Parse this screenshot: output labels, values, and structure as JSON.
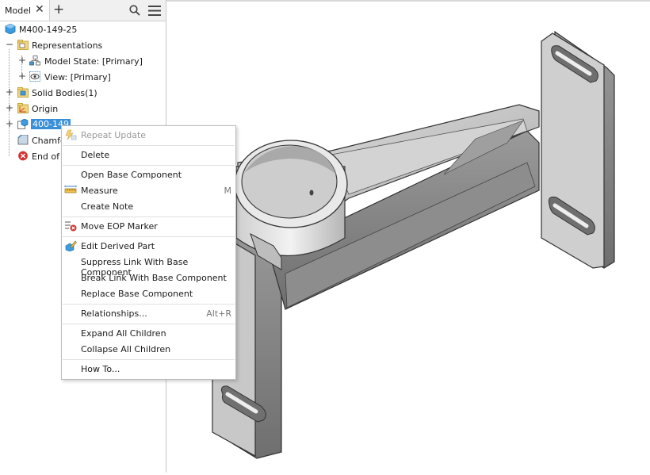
{
  "browser": {
    "tab_label": "Model",
    "tab_close": "✕",
    "tab_add": "+",
    "tree": {
      "root": "M400-149-25",
      "representations": "Representations",
      "model_state": "Model State: [Primary]",
      "view": "View: [Primary]",
      "solid_bodies": "Solid Bodies(1)",
      "origin": "Origin",
      "derived_part": "400-149",
      "chamfer": "Chamfe",
      "end_of_part": "End of P"
    }
  },
  "context_menu": {
    "items": [
      {
        "label": "Repeat Update",
        "shortcut": "",
        "enabled": false
      },
      {
        "label": "Delete",
        "shortcut": "",
        "enabled": true
      },
      {
        "label": "Open Base Component",
        "shortcut": "",
        "enabled": true
      },
      {
        "label": "Measure",
        "shortcut": "M",
        "enabled": true
      },
      {
        "label": "Create Note",
        "shortcut": "",
        "enabled": true
      },
      {
        "label": "Move EOP Marker",
        "shortcut": "",
        "enabled": true
      },
      {
        "label": "Edit Derived Part",
        "shortcut": "",
        "enabled": true
      },
      {
        "label": "Suppress Link With Base Component",
        "shortcut": "",
        "enabled": true
      },
      {
        "label": "Break Link With Base Component",
        "shortcut": "",
        "enabled": true
      },
      {
        "label": "Replace Base Component",
        "shortcut": "",
        "enabled": true
      },
      {
        "label": "Relationships...",
        "shortcut": "Alt+R",
        "enabled": true
      },
      {
        "label": "Expand All Children",
        "shortcut": "",
        "enabled": true
      },
      {
        "label": "Collapse All Children",
        "shortcut": "",
        "enabled": true
      },
      {
        "label": "How To...",
        "shortcut": "",
        "enabled": true
      }
    ]
  },
  "colors": {
    "selection": "#3a8fd9",
    "model_gray": "#b9b9b9",
    "folder_yellow": "#e8c85a",
    "part_blue": "#3d9be0",
    "error_red": "#d43030"
  }
}
